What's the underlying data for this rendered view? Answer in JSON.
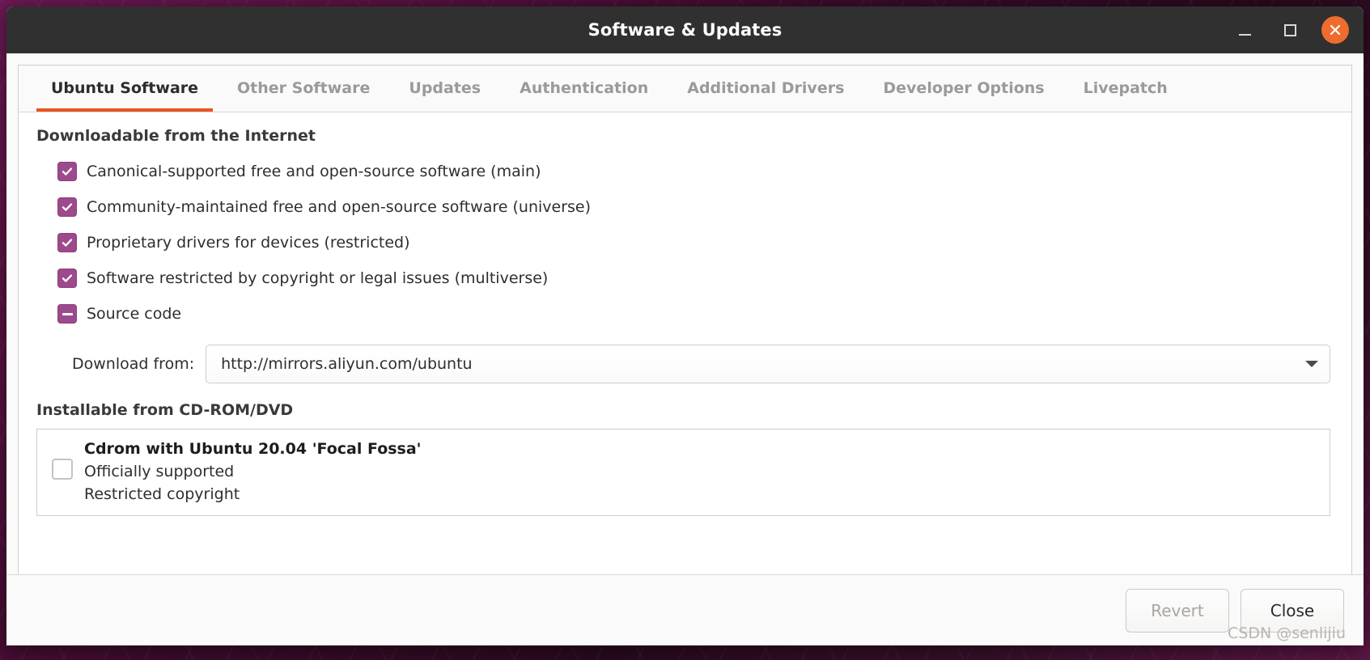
{
  "window": {
    "title": "Software & Updates",
    "controls": {
      "minimize": "minimize",
      "maximize": "maximize",
      "close": "close"
    }
  },
  "tabs": [
    {
      "label": "Ubuntu Software",
      "active": true
    },
    {
      "label": "Other Software",
      "active": false
    },
    {
      "label": "Updates",
      "active": false
    },
    {
      "label": "Authentication",
      "active": false
    },
    {
      "label": "Additional Drivers",
      "active": false
    },
    {
      "label": "Developer Options",
      "active": false
    },
    {
      "label": "Livepatch",
      "active": false
    }
  ],
  "main": {
    "downloadable_title": "Downloadable from the Internet",
    "repositories": [
      {
        "label": "Canonical-supported free and open-source software (main)",
        "state": "checked"
      },
      {
        "label": "Community-maintained free and open-source software (universe)",
        "state": "checked"
      },
      {
        "label": "Proprietary drivers for devices (restricted)",
        "state": "checked"
      },
      {
        "label": "Software restricted by copyright or legal issues (multiverse)",
        "state": "checked"
      },
      {
        "label": "Source code",
        "state": "indeterminate"
      }
    ],
    "download_from": {
      "label": "Download from:",
      "value": "http://mirrors.aliyun.com/ubuntu"
    },
    "cdrom": {
      "title": "Installable from CD-ROM/DVD",
      "item": {
        "name": "Cdrom with Ubuntu 20.04 'Focal Fossa'",
        "line2": "Officially supported",
        "line3": "Restricted copyright",
        "state": "unchecked"
      }
    }
  },
  "footer": {
    "revert_label": "Revert",
    "revert_enabled": false,
    "close_label": "Close",
    "close_enabled": true
  },
  "watermark": "CSDN @senlijiu",
  "colors": {
    "accent": "#e95420",
    "checkbox": "#9c4a8b",
    "titlebar": "#303030",
    "close_button": "#ef6c2e"
  }
}
